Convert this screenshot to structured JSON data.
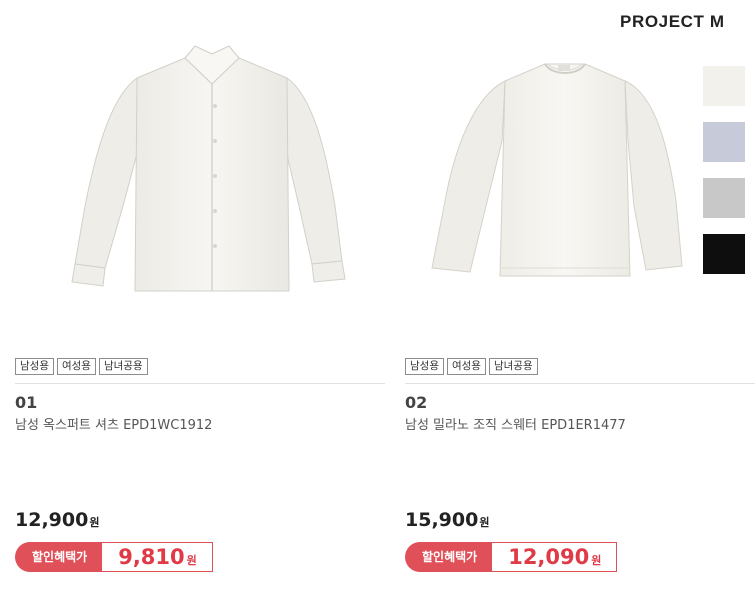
{
  "brand": "PROJECT M",
  "products": [
    {
      "tags": [
        "남성용",
        "여성용",
        "남녀공용"
      ],
      "number": "01",
      "name": "남성 옥스퍼트 셔츠 EPD1WC1912",
      "price": "12,900",
      "price_unit": "원",
      "sale_label": "할인혜택가",
      "sale_price": "9,810",
      "sale_unit": "원",
      "image": "white-oxford-shirt"
    },
    {
      "tags": [
        "남성용",
        "여성용",
        "남녀공용"
      ],
      "number": "02",
      "name": "남성 밀라노 조직 스웨터 EPD1ER1477",
      "price": "15,900",
      "price_unit": "원",
      "sale_label": "할인혜택가",
      "sale_price": "12,090",
      "sale_unit": "원",
      "image": "ivory-crewneck-sweater"
    }
  ],
  "swatches": [
    {
      "color_name": "ivory",
      "color": "#f3f1ec"
    },
    {
      "color_name": "light-blue",
      "color": "#c6cad9"
    },
    {
      "color_name": "light-gray",
      "color": "#c8c8c8"
    },
    {
      "color_name": "black",
      "color": "#0e0e0e"
    }
  ],
  "colors": {
    "accent": "#e05058",
    "sale_text": "#e03a46"
  }
}
